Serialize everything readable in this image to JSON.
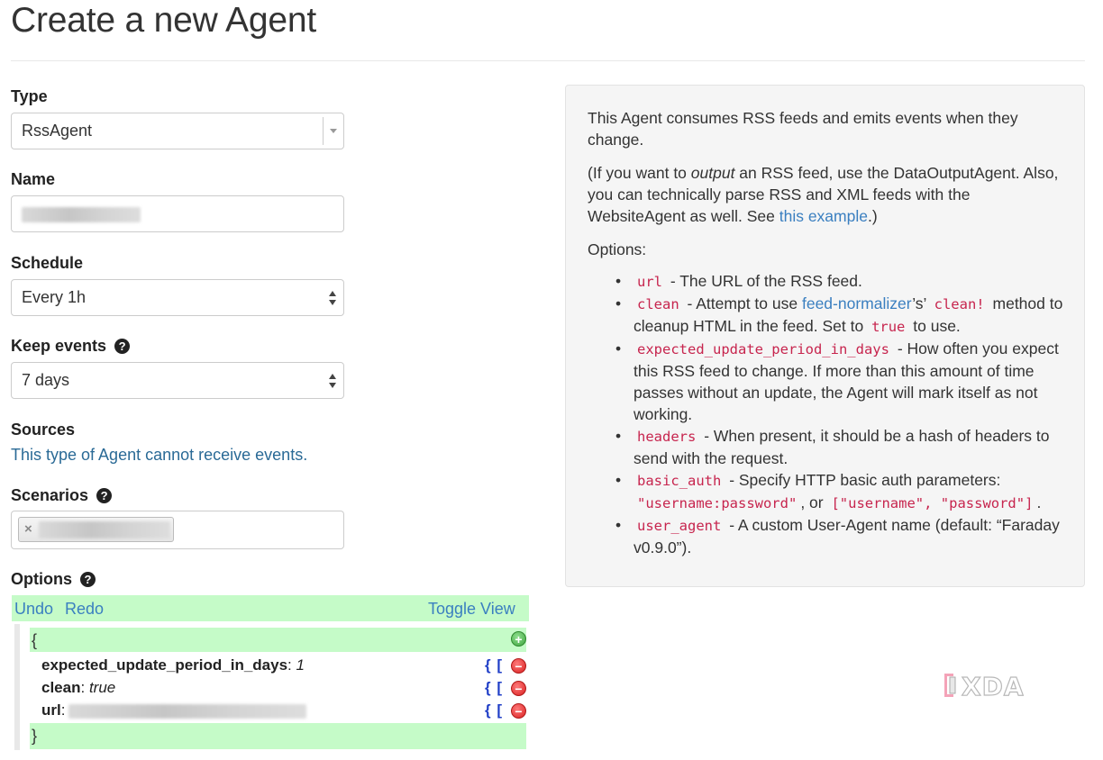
{
  "page": {
    "title": "Create a new Agent"
  },
  "form": {
    "type": {
      "label": "Type",
      "value": "RssAgent"
    },
    "name": {
      "label": "Name"
    },
    "schedule": {
      "label": "Schedule",
      "value": "Every 1h"
    },
    "keep_events": {
      "label": "Keep events",
      "help": "?",
      "value": "7 days"
    },
    "sources": {
      "label": "Sources",
      "text": "This type of Agent cannot receive events."
    },
    "scenarios": {
      "label": "Scenarios",
      "help": "?",
      "tag_remove": "×"
    },
    "options": {
      "label": "Options",
      "help": "?"
    }
  },
  "editor": {
    "undo": "Undo",
    "redo": "Redo",
    "toggle_view": "Toggle View",
    "open_brace": "{",
    "close_brace": "}",
    "tools": "{ [",
    "rows": [
      {
        "key": "expected_update_period_in_days",
        "value": "1"
      },
      {
        "key": "clean",
        "value": "true"
      },
      {
        "key": "url",
        "value": ""
      }
    ]
  },
  "info": {
    "p1": "This Agent consumes RSS feeds and emits events when they change.",
    "p2_a": "(If you want to ",
    "p2_em": "output",
    "p2_b": " an RSS feed, use the DataOutputAgent. Also, you can technically parse RSS and XML feeds with the WebsiteAgent as well. See ",
    "p2_link": "this example",
    "p2_c": ".)",
    "options_heading": "Options:",
    "items": {
      "url": {
        "code": "url",
        "text": " - The URL of the RSS feed."
      },
      "clean": {
        "code": "clean",
        "t1": " - Attempt to use ",
        "link": "feed-normalizer",
        "t2": "’s’ ",
        "code2": "clean!",
        "t3": " method to cleanup HTML in the feed. Set to ",
        "code3": "true",
        "t4": " to use."
      },
      "expected": {
        "code": "expected_update_period_in_days",
        "text": " - How often you expect this RSS feed to change. If more than this amount of time passes without an update, the Agent will mark itself as not working."
      },
      "headers": {
        "code": "headers",
        "text": " - When present, it should be a hash of headers to send with the request."
      },
      "basic_auth": {
        "code": "basic_auth",
        "t1": " - Specify HTTP basic auth parameters: ",
        "code2": "\"username:password\"",
        "t2": ", or ",
        "code3": "[\"username\", \"password\"]",
        "t3": "."
      },
      "user_agent": {
        "code": "user_agent",
        "text": " - A custom User-Agent name (default: “Faraday v0.9.0”)."
      }
    }
  },
  "watermark": {
    "text": "XDA"
  },
  "colors": {
    "link": "#3a7fc0",
    "code": "#c7254e",
    "editor_bg": "#c5fbc8"
  }
}
